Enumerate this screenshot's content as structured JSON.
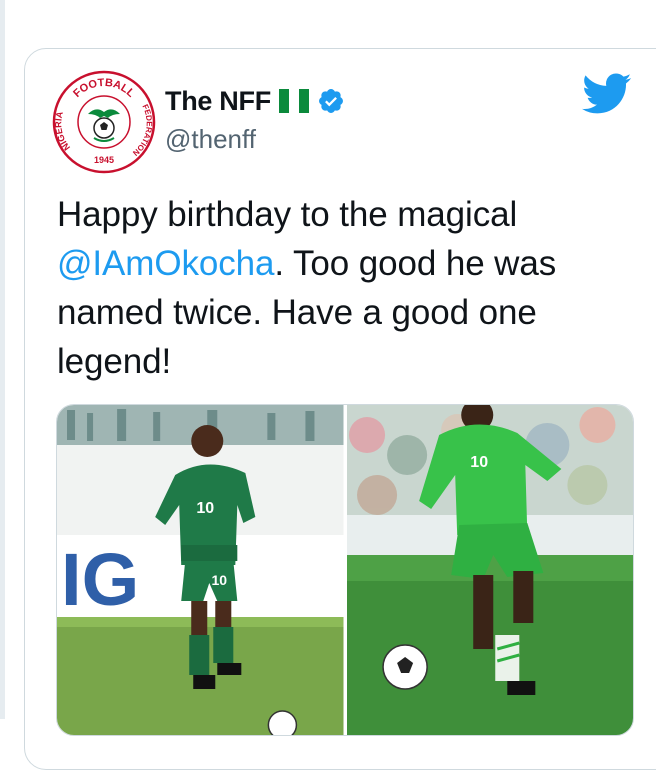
{
  "tweet": {
    "display_name": "The NFF",
    "handle": "@thenff",
    "text_before": "Happy birthday to the magical ",
    "mention": "@IAmOkocha",
    "text_after": ". Too good he was named twice. Have a good one legend!"
  },
  "avatar": {
    "logo_top": "FOOTBALL",
    "logo_left": "NIGERIA",
    "logo_right": "FEDERATION",
    "logo_year": "1945"
  },
  "photos": {
    "left_shirt_number": "10",
    "left_shorts_number": "10",
    "left_sign_text": "IG",
    "right_shirt_number": "10"
  },
  "icons": {
    "verified": "verified-badge-icon",
    "bird": "twitter-bird-icon",
    "flag": "nigeria-flag-icon"
  },
  "colors": {
    "accent": "#1d9bf0",
    "flag_green": "#0b8a3c",
    "nff_red": "#c8102e",
    "kit_green_left": "#1f7a48",
    "kit_green_right": "#38c24a"
  }
}
